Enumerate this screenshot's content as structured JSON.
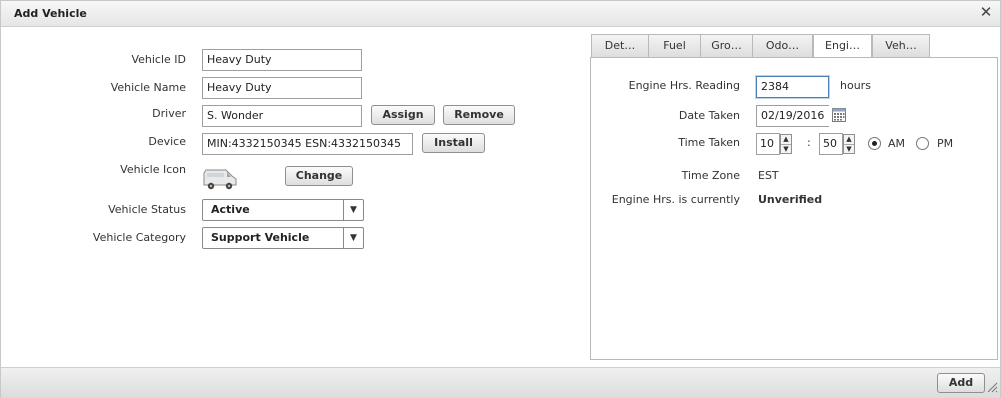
{
  "window": {
    "title": "Add Vehicle",
    "close_glyph": "✕"
  },
  "form": {
    "vehicle_id": {
      "label": "Vehicle ID",
      "value": "Heavy Duty"
    },
    "vehicle_name": {
      "label": "Vehicle Name",
      "value": "Heavy Duty"
    },
    "driver": {
      "label": "Driver",
      "value": "S. Wonder",
      "assign_label": "Assign",
      "remove_label": "Remove"
    },
    "device": {
      "label": "Device",
      "value": "MIN:4332150345 ESN:4332150345",
      "install_label": "Install"
    },
    "vehicle_icon": {
      "label": "Vehicle Icon",
      "icon": "van-icon",
      "change_label": "Change"
    },
    "vehicle_status": {
      "label": "Vehicle Status",
      "selected": "Active"
    },
    "vehicle_category": {
      "label": "Vehicle Category",
      "selected": "Support Vehicle"
    }
  },
  "tabs": [
    {
      "label": "Det…"
    },
    {
      "label": "Fuel"
    },
    {
      "label": "Gro…"
    },
    {
      "label": "Odo…"
    },
    {
      "label": "Engi…",
      "active": true
    },
    {
      "label": "Veh…"
    }
  ],
  "engine": {
    "hours_reading_label": "Engine Hrs. Reading",
    "hours_value": "2384",
    "hours_unit": "hours",
    "date_taken_label": "Date Taken",
    "date_value": "02/19/2016",
    "time_taken_label": "Time Taken",
    "hour_value": "10",
    "minute_value": "50",
    "time_separator": ":",
    "am_label": "AM",
    "pm_label": "PM",
    "am_selected": true,
    "time_zone_label": "Time Zone",
    "time_zone_value": "EST",
    "status_label": "Engine Hrs. is currently",
    "status_value": "Unverified"
  },
  "footer": {
    "add_label": "Add"
  },
  "spinner_glyphs": {
    "up": "▲",
    "down": "▼"
  },
  "select_arrow": "▼"
}
